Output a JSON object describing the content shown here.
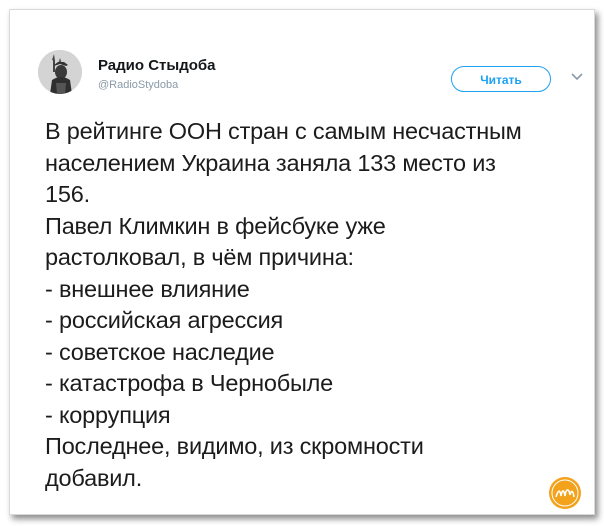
{
  "account": {
    "display_name": "Радио Стыдоба",
    "handle": "@RadioStydoba"
  },
  "follow_button": {
    "label": "Читать"
  },
  "icons": {
    "avatar": "statue-of-liberty-avatar",
    "menu": "chevron-down-icon",
    "watermark": "nika-logo-watermark"
  },
  "tweet": {
    "lines": [
      "В рейтинге ООН стран с самым несчастным",
      "населением Украина заняла 133 место из",
      "156.",
      "Павел Климкин в фейсбуке уже",
      "растолковал, в чём причина:",
      "- внешнее влияние",
      "- российская агрессия",
      "- советское наследие",
      "- катастрофа в Чернобыле",
      "- коррупция",
      "Последнее, видимо, из скромности",
      "добавил."
    ]
  },
  "colors": {
    "accent": "#1da1f2",
    "text": "#1c1c1c",
    "handle": "#8a9aa8",
    "watermark": "#f3a21c"
  }
}
